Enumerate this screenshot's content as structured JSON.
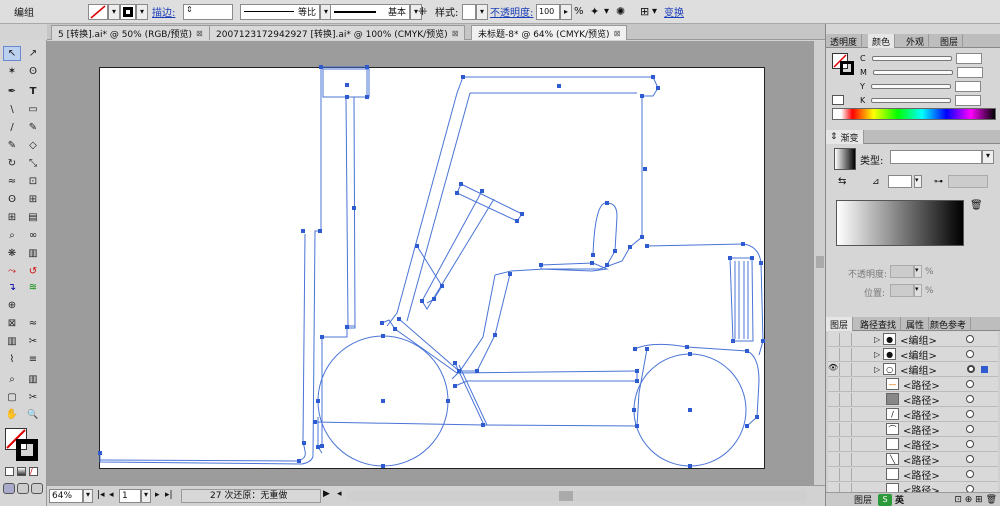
{
  "control_bar": {
    "group_label": "编组",
    "stroke_label": "描边:",
    "stroke_line_label": "等比",
    "brush_label": "基本",
    "style_label": "样式:",
    "opacity_label": "不透明度:",
    "opacity_value": "100",
    "percent": "%",
    "transform_label": "变换"
  },
  "tabs": [
    {
      "label": "5 [转换].ai* @ 50% (RGB/预览)"
    },
    {
      "label": "2007123172942927 [转换].ai* @ 100% (CMYK/预览)"
    },
    {
      "label": "未标题-8* @ 64% (CMYK/预览)"
    }
  ],
  "tools": {
    "select": "↖",
    "direct_select": "↗",
    "magic_wand": "✶",
    "lasso": "ʘ",
    "pen": "✒",
    "type": "T",
    "line": "\\",
    "rect": "▭",
    "brush": "/",
    "pencil": "✎",
    "eraser": "◇",
    "rotate": "↻",
    "scale": "⤡",
    "warp": "≈",
    "free_transform": "⊡",
    "symbol": "❋",
    "graph": "▥",
    "mesh": "⊞",
    "gradient": "▤",
    "eyedropper": "⌕",
    "blend": "∞",
    "scissors": "✂",
    "hand": "✋",
    "zoom": "🔍"
  },
  "status": {
    "zoom": "64%",
    "page": "1",
    "undo_text": "27 次还原：无重做"
  },
  "color_panel": {
    "tabs": [
      "透明度",
      "颜色",
      "外观",
      "图层"
    ],
    "channels": [
      "C",
      "M",
      "Y",
      "K"
    ]
  },
  "gradient_panel": {
    "title": "渐变",
    "type_label": "类型:",
    "opacity_label": "不透明度:",
    "position_label": "位置:",
    "percent": "%"
  },
  "layers_panel": {
    "tabs": [
      "图层",
      "路径查找",
      "属性",
      "颜色参考"
    ],
    "items": [
      {
        "label": "<编组>"
      },
      {
        "label": "<编组>"
      },
      {
        "label": "<编组>"
      },
      {
        "label": "<路径>"
      },
      {
        "label": "<路径>"
      },
      {
        "label": "<路径>"
      },
      {
        "label": "<路径>"
      },
      {
        "label": "<路径>"
      },
      {
        "label": "<路径>"
      },
      {
        "label": "<路径>"
      },
      {
        "label": "<路径>"
      }
    ],
    "footer_label": "图层",
    "ime_label": "英"
  },
  "colors": {
    "path_blue": "#4a74d6",
    "anchor_blue": "#2f5bd0",
    "canvas_gray": "#9c9c9c"
  }
}
